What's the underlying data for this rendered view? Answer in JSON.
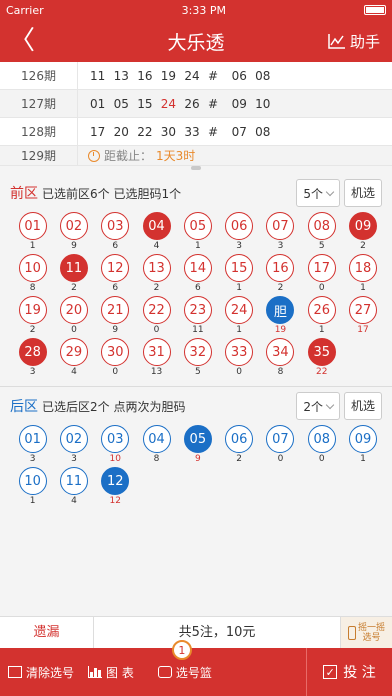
{
  "status_bar": {
    "carrier": "Carrier",
    "time": "3:33 PM"
  },
  "nav": {
    "back": "〈",
    "title": "大乐透",
    "helper_label": "助手"
  },
  "history": [
    {
      "issue": "126期",
      "numbers": [
        "11",
        "13",
        "16",
        "19",
        "24",
        "#",
        "06",
        "08"
      ],
      "hot": []
    },
    {
      "issue": "127期",
      "numbers": [
        "01",
        "05",
        "15",
        "24",
        "26",
        "#",
        "09",
        "10"
      ],
      "hot": [
        3
      ]
    },
    {
      "issue": "128期",
      "numbers": [
        "17",
        "20",
        "22",
        "30",
        "33",
        "#",
        "07",
        "08"
      ],
      "hot": []
    }
  ],
  "current_issue": {
    "issue": "129期",
    "countdown_label": "距截止：",
    "countdown_value": "1天3时"
  },
  "front": {
    "name": "前区",
    "info": "已选前区6个 已选胆码1个",
    "count_select": "5个",
    "random_label": "机选",
    "balls": [
      {
        "n": "01",
        "m": "1",
        "s": ""
      },
      {
        "n": "02",
        "m": "9",
        "s": ""
      },
      {
        "n": "03",
        "m": "6",
        "s": ""
      },
      {
        "n": "04",
        "m": "4",
        "s": "red"
      },
      {
        "n": "05",
        "m": "1",
        "s": ""
      },
      {
        "n": "06",
        "m": "3",
        "s": ""
      },
      {
        "n": "07",
        "m": "3",
        "s": ""
      },
      {
        "n": "08",
        "m": "5",
        "s": ""
      },
      {
        "n": "09",
        "m": "2",
        "s": "red"
      },
      {
        "n": "10",
        "m": "8",
        "s": ""
      },
      {
        "n": "11",
        "m": "2",
        "s": "red"
      },
      {
        "n": "12",
        "m": "6",
        "s": ""
      },
      {
        "n": "13",
        "m": "2",
        "s": ""
      },
      {
        "n": "14",
        "m": "6",
        "s": ""
      },
      {
        "n": "15",
        "m": "1",
        "s": ""
      },
      {
        "n": "16",
        "m": "2",
        "s": ""
      },
      {
        "n": "17",
        "m": "0",
        "s": ""
      },
      {
        "n": "18",
        "m": "1",
        "s": ""
      },
      {
        "n": "19",
        "m": "2",
        "s": ""
      },
      {
        "n": "20",
        "m": "0",
        "s": ""
      },
      {
        "n": "21",
        "m": "9",
        "s": ""
      },
      {
        "n": "22",
        "m": "0",
        "s": ""
      },
      {
        "n": "23",
        "m": "11",
        "s": ""
      },
      {
        "n": "24",
        "m": "1",
        "s": ""
      },
      {
        "n": "胆",
        "m": "19",
        "s": "dan",
        "hot": true
      },
      {
        "n": "26",
        "m": "1",
        "s": ""
      },
      {
        "n": "27",
        "m": "17",
        "s": "",
        "hot": true
      },
      {
        "n": "28",
        "m": "3",
        "s": "red"
      },
      {
        "n": "29",
        "m": "4",
        "s": ""
      },
      {
        "n": "30",
        "m": "0",
        "s": ""
      },
      {
        "n": "31",
        "m": "13",
        "s": ""
      },
      {
        "n": "32",
        "m": "5",
        "s": ""
      },
      {
        "n": "33",
        "m": "0",
        "s": ""
      },
      {
        "n": "34",
        "m": "8",
        "s": ""
      },
      {
        "n": "35",
        "m": "22",
        "s": "red",
        "hot": true
      }
    ]
  },
  "back": {
    "name": "后区",
    "info": "已选后区2个 点两次为胆码",
    "count_select": "2个",
    "random_label": "机选",
    "balls": [
      {
        "n": "01",
        "m": "3",
        "s": ""
      },
      {
        "n": "02",
        "m": "3",
        "s": ""
      },
      {
        "n": "03",
        "m": "10",
        "s": "",
        "hot": true
      },
      {
        "n": "04",
        "m": "8",
        "s": ""
      },
      {
        "n": "05",
        "m": "9",
        "s": "blue",
        "hot": true
      },
      {
        "n": "06",
        "m": "2",
        "s": ""
      },
      {
        "n": "07",
        "m": "0",
        "s": ""
      },
      {
        "n": "08",
        "m": "0",
        "s": ""
      },
      {
        "n": "09",
        "m": "1",
        "s": ""
      },
      {
        "n": "10",
        "m": "1",
        "s": ""
      },
      {
        "n": "11",
        "m": "4",
        "s": ""
      },
      {
        "n": "12",
        "m": "12",
        "s": "blue",
        "hot": true
      }
    ]
  },
  "bottom": {
    "yilou_label": "遗漏",
    "total_label": "共5注，10元",
    "shake_line1": "摇一摇",
    "shake_line2": "选号"
  },
  "tabbar": {
    "clear_label": "清除选号",
    "chart_label": "图 表",
    "basket_label": "选号篮",
    "basket_count": "1",
    "submit_label": "投 注"
  },
  "colors": {
    "brand_red": "#d3322f",
    "blue": "#1b6fc6",
    "orange": "#e98a2c"
  }
}
